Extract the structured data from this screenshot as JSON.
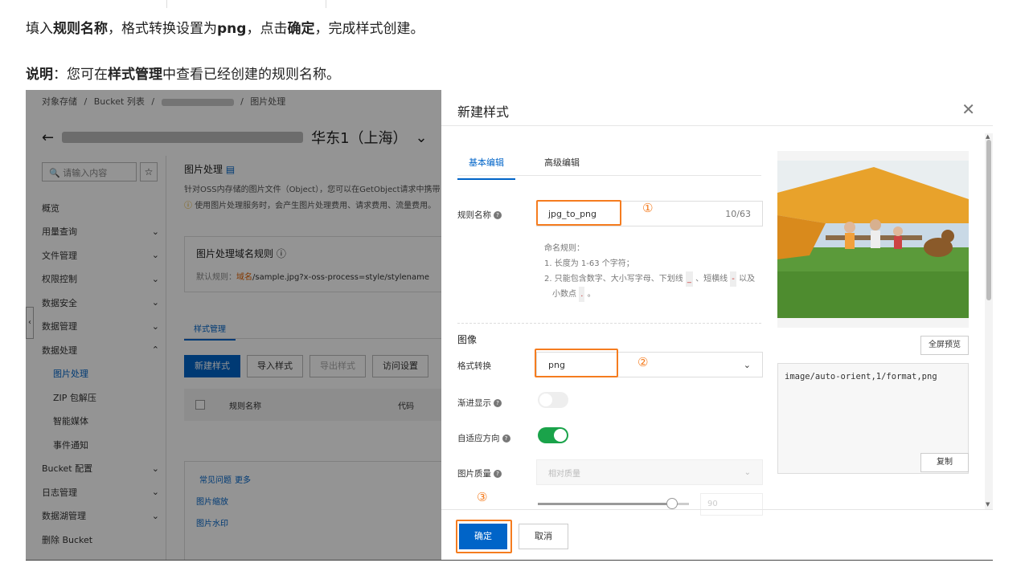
{
  "doc": {
    "line1": {
      "t1": "填入",
      "b1": "规则名称",
      "t2": "，格式转换设置为",
      "b2": "png",
      "t3": "，点击",
      "b3": "确定",
      "t4": "，完成样式创建。"
    },
    "line2": {
      "b1": "说明",
      "t1": "：您可在",
      "b2": "样式管理",
      "t2": "中查看已经创建的规则名称。"
    }
  },
  "console": {
    "breadcrumb": [
      "对象存储",
      "/",
      "Bucket 列表",
      "/",
      "/",
      "图片处理"
    ],
    "back_icon": "arrow-left-icon",
    "header_suffix": "华东1（上海）",
    "search_placeholder": "请输入内容",
    "nav": [
      {
        "label": "概览",
        "arrow": ""
      },
      {
        "label": "用量查询",
        "arrow": "⌄"
      },
      {
        "label": "文件管理",
        "arrow": "⌄"
      },
      {
        "label": "权限控制",
        "arrow": "⌄"
      },
      {
        "label": "数据安全",
        "arrow": "⌄"
      },
      {
        "label": "数据管理",
        "arrow": "⌄"
      },
      {
        "label": "数据处理",
        "arrow": "⌃"
      },
      {
        "label": "图片处理",
        "arrow": ""
      },
      {
        "label": "ZIP 包解压",
        "arrow": ""
      },
      {
        "label": "智能媒体",
        "arrow": ""
      },
      {
        "label": "事件通知",
        "arrow": ""
      },
      {
        "label": "Bucket 配置",
        "arrow": "⌄"
      },
      {
        "label": "日志管理",
        "arrow": "⌄"
      },
      {
        "label": "数据湖管理",
        "arrow": "⌄"
      },
      {
        "label": "删除 Bucket",
        "arrow": ""
      }
    ],
    "main_title": "图片处理",
    "main_desc": "针对OSS内存储的图片文件（Object），您可以在GetObject请求中携带",
    "main_warn": "使用图片处理服务时，会产生图片处理费用、请求费用、流量费用。",
    "domain_title": "图片处理域名规则",
    "domain_rule_prefix": "默认规则：",
    "domain_rule_highlight": "域名",
    "domain_rule_rest": "/sample.jpg?x-oss-process=style/stylename",
    "tab": "样式管理",
    "buttons": [
      "新建样式",
      "导入样式",
      "导出样式",
      "访问设置"
    ],
    "col_name": "规则名称",
    "col_code": "代码",
    "faq_title": "常见问题",
    "faq_more": "更多",
    "faq_links": [
      "图片缩放",
      "图片水印"
    ]
  },
  "panel": {
    "title": "新建样式",
    "tabs": [
      "基本编辑",
      "高级编辑"
    ],
    "rule_name_label": "规则名称",
    "rule_name_value": "jpg_to_png",
    "rule_name_count": "10/63",
    "naming_title": "命名规则：",
    "naming_1": "1. 长度为 1-63 个字符；",
    "naming_2a": "2. 只能包含数字、大小写字母、下划线",
    "naming_2b": "、短横线",
    "naming_2c": "以及",
    "naming_2d": "小数点",
    "naming_2e": "。",
    "sym_underscore": "_",
    "sym_dash": "-",
    "sym_dot": ".",
    "section_image": "图像",
    "format_label": "格式转换",
    "format_value": "png",
    "progressive_label": "渐进显示",
    "progressive_on": false,
    "autoorient_label": "自适应方向",
    "autoorient_on": true,
    "quality_label": "图片质量",
    "quality_value": "相对质量",
    "quality_number": "90",
    "ok": "确定",
    "cancel": "取消",
    "full_preview": "全屏预览",
    "code": "image/auto-orient,1/format,png",
    "copy": "复制",
    "markers": [
      "①",
      "②",
      "③"
    ]
  }
}
